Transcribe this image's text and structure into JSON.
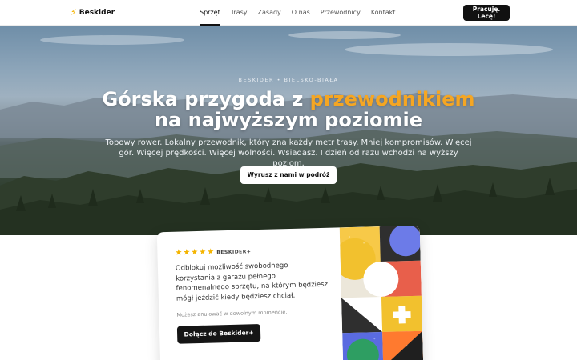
{
  "nav": {
    "brand": "Beskider",
    "brand_icon": "bolt-icon",
    "items": [
      {
        "label": "Sprzęt",
        "active": true
      },
      {
        "label": "Trasy",
        "active": false
      },
      {
        "label": "Zasady",
        "active": false
      },
      {
        "label": "O nas",
        "active": false
      },
      {
        "label": "Przewodnicy",
        "active": false
      },
      {
        "label": "Kontakt",
        "active": false
      }
    ],
    "cta_line1": "Pracuję.",
    "cta_line2": "Lecę!"
  },
  "hero": {
    "eyebrow": "BESKIDER • BIELSKO-BIAŁA",
    "title_part1": "Górska przygoda z ",
    "title_accent": "przewodnikiem",
    "title_part2": "na najwyższym poziomie",
    "subtitle": "Topowy rower. Lokalny przewodnik, który zna każdy metr trasy. Mniej kompromisów. Więcej gór. Więcej prędkości. Więcej wolności. Wsiadasz. I dzień od razu wchodzi na wyższy poziom.",
    "button": "Wyrusz z nami w podróż"
  },
  "card": {
    "rating_stars": 5,
    "badge": "BESKIDER+",
    "text": "Odblokuj możliwość swobodnego korzystania z garażu pełnego fenomenalnego sprzętu, na którym będziesz mógł jeździć kiedy będziesz chciał.",
    "note": "Możesz anulować w dowolnym momencie.",
    "button": "Dołącz do Beskider+"
  },
  "colors": {
    "accent": "#f5a623",
    "star": "#f4b400",
    "dark_button": "#151515"
  }
}
